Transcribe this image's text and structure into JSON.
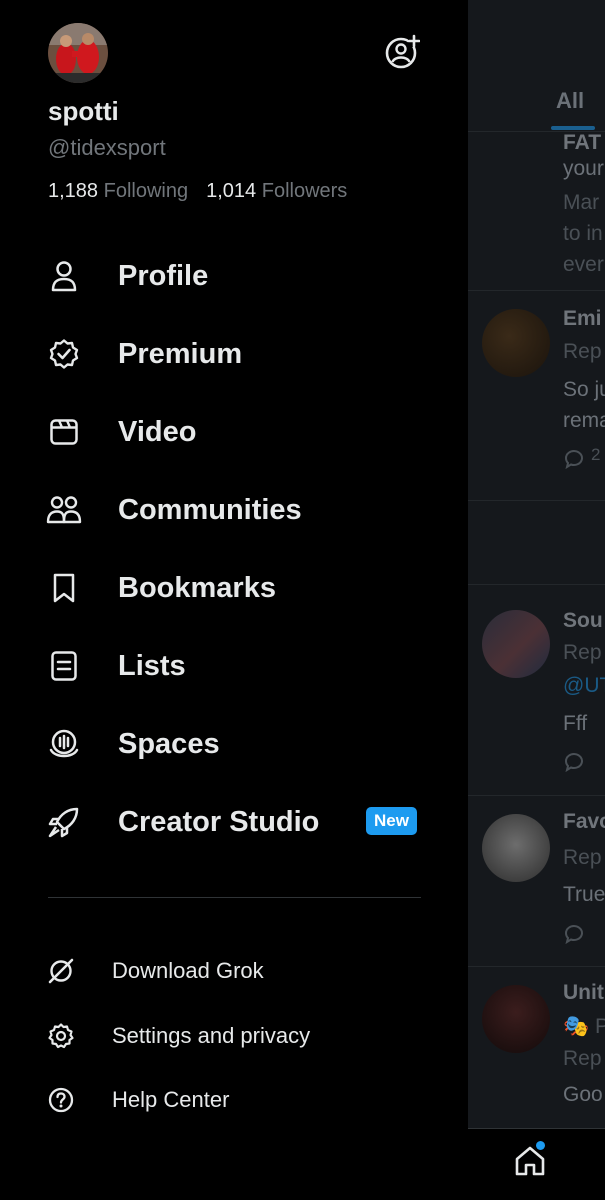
{
  "profile": {
    "display_name": "spotti",
    "handle": "@tidexsport",
    "following_count": "1,188",
    "following_label": "Following",
    "followers_count": "1,014",
    "followers_label": "Followers",
    "add_account_icon": "add-account-icon"
  },
  "nav": {
    "items": [
      {
        "label": "Profile",
        "icon": "person-icon"
      },
      {
        "label": "Premium",
        "icon": "verified-badge-icon"
      },
      {
        "label": "Video",
        "icon": "video-icon"
      },
      {
        "label": "Communities",
        "icon": "communities-icon"
      },
      {
        "label": "Bookmarks",
        "icon": "bookmark-icon"
      },
      {
        "label": "Lists",
        "icon": "list-icon"
      },
      {
        "label": "Spaces",
        "icon": "spaces-icon"
      },
      {
        "label": "Creator Studio",
        "icon": "rocket-icon",
        "badge": "New"
      }
    ]
  },
  "secondary": {
    "items": [
      {
        "label": "Download Grok",
        "icon": "grok-icon"
      },
      {
        "label": "Settings and privacy",
        "icon": "gear-icon"
      },
      {
        "label": "Help Center",
        "icon": "help-icon"
      }
    ]
  },
  "feed": {
    "tab_label": "All",
    "post1": {
      "line1": "FAT",
      "line2": "your",
      "line3": "Mar",
      "line4": "to in",
      "line5": "ever"
    },
    "post2": {
      "name": "Emi",
      "meta": "Rep",
      "line1": "So ju",
      "line2": "rema",
      "count": "2"
    },
    "post3": {
      "name": "Sou",
      "meta": "Rep",
      "mention": "@UT",
      "text": "Fff"
    },
    "post4": {
      "name": "Favo",
      "meta": "Rep",
      "text": "True"
    },
    "post5": {
      "name": "Unit",
      "meta_line": "🎭 P",
      "meta": "Rep",
      "text": "Goo"
    }
  },
  "bottom_nav": {
    "home_icon": "home-icon"
  },
  "colors": {
    "background": "#000000",
    "text": "#e7e9ea",
    "muted": "#71767b",
    "accent": "#1d9bf0",
    "divider": "#2f3336"
  }
}
